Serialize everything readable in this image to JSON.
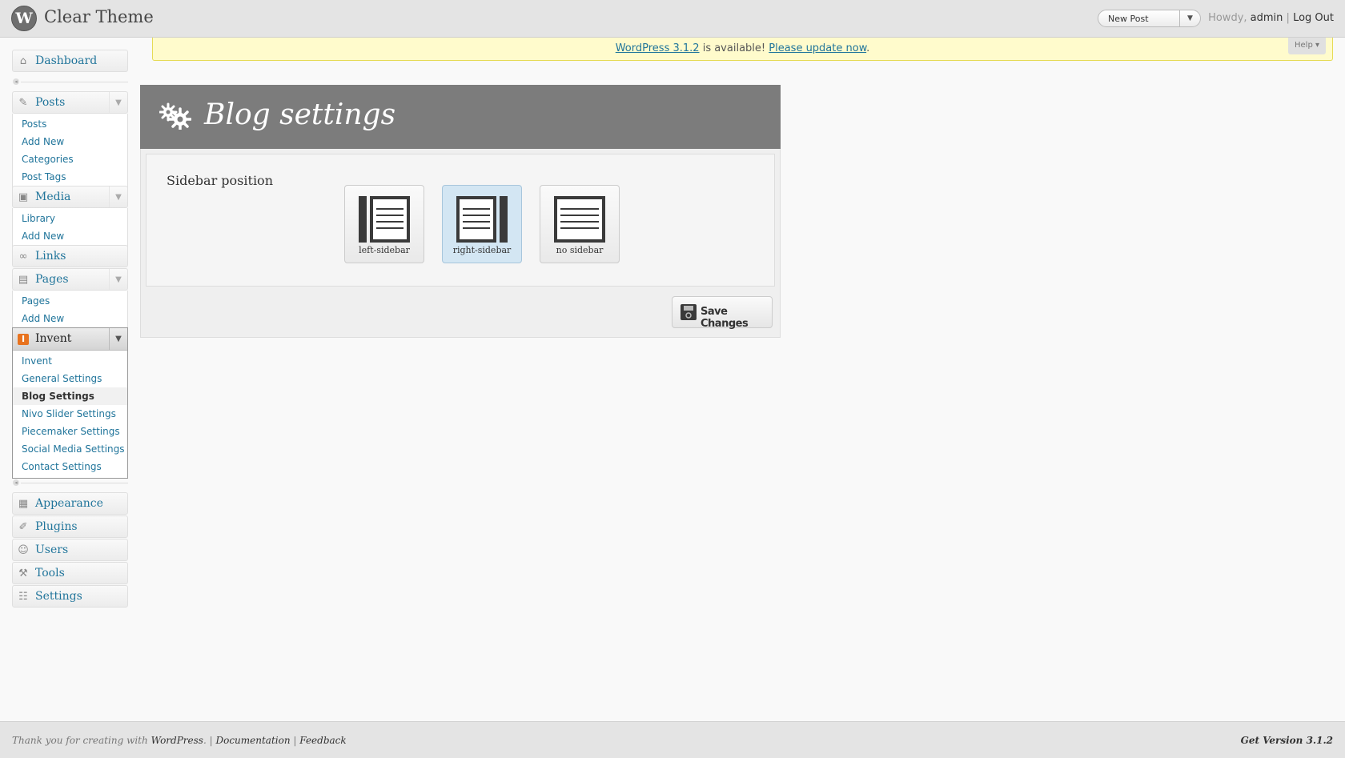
{
  "header": {
    "logo_glyph": "W",
    "site_title": "Clear Theme",
    "favorite_action": "New Post",
    "howdy": "Howdy,",
    "user": "admin",
    "separator": "|",
    "logout": "Log Out"
  },
  "update_nag": {
    "version_link": "WordPress 3.1.2",
    "middle": "is available!",
    "update_link": "Please update now",
    "end": "."
  },
  "help_tab": "Help ▾",
  "menu": {
    "dashboard": "Dashboard",
    "posts": {
      "label": "Posts",
      "items": [
        "Posts",
        "Add New",
        "Categories",
        "Post Tags"
      ]
    },
    "media": {
      "label": "Media",
      "items": [
        "Library",
        "Add New"
      ]
    },
    "links": "Links",
    "pages": {
      "label": "Pages",
      "items": [
        "Pages",
        "Add New"
      ]
    },
    "invent": {
      "icon_glyph": "I",
      "label": "Invent",
      "items": [
        "Invent",
        "General Settings",
        "Blog Settings",
        "Nivo Slider Settings",
        "Piecemaker Settings",
        "Social Media Settings",
        "Contact Settings"
      ],
      "current": "Blog Settings"
    },
    "appearance": "Appearance",
    "plugins": "Plugins",
    "users": "Users",
    "tools": "Tools",
    "settings": "Settings"
  },
  "panel": {
    "title": "Blog settings",
    "option_label": "Sidebar position",
    "options": [
      {
        "caption": "left-sidebar",
        "selected": false
      },
      {
        "caption": "right-sidebar",
        "selected": true
      },
      {
        "caption": "no sidebar",
        "selected": false
      }
    ],
    "save_label": "Save Changes"
  },
  "footer": {
    "thanks": "Thank you for creating with",
    "wordpress": "WordPress",
    "period": ".",
    "sep": "|",
    "documentation": "Documentation",
    "feedback": "Feedback",
    "version": "Get Version 3.1.2"
  },
  "colors": {
    "accent": "#21759b",
    "header_bg": "#e4e4e4",
    "panel_header": "#7c7c7c",
    "nag_bg": "#fffbcc",
    "selected_option": "#d3e6f3",
    "invent_icon": "#e8731f"
  }
}
